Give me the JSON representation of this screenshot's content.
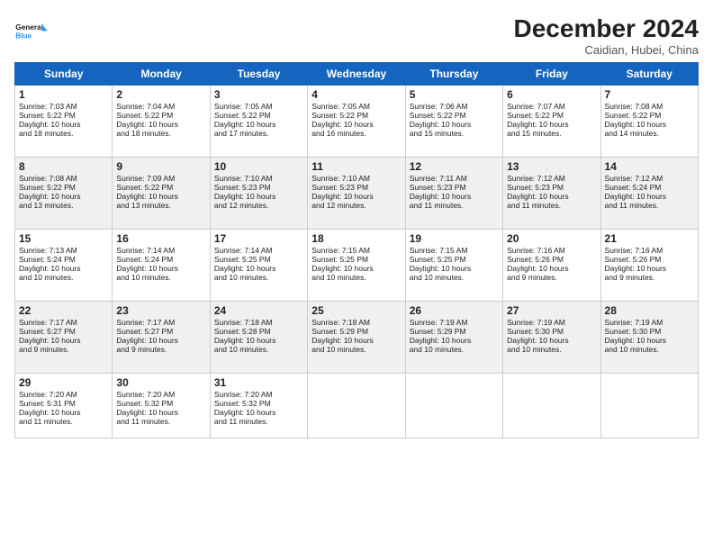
{
  "logo": {
    "line1": "General",
    "line2": "Blue"
  },
  "header": {
    "title": "December 2024",
    "location": "Caidian, Hubei, China"
  },
  "weekdays": [
    "Sunday",
    "Monday",
    "Tuesday",
    "Wednesday",
    "Thursday",
    "Friday",
    "Saturday"
  ],
  "weeks": [
    [
      {
        "day": 1,
        "lines": [
          "Sunrise: 7:03 AM",
          "Sunset: 5:22 PM",
          "Daylight: 10 hours",
          "and 18 minutes."
        ]
      },
      {
        "day": 2,
        "lines": [
          "Sunrise: 7:04 AM",
          "Sunset: 5:22 PM",
          "Daylight: 10 hours",
          "and 18 minutes."
        ]
      },
      {
        "day": 3,
        "lines": [
          "Sunrise: 7:05 AM",
          "Sunset: 5:22 PM",
          "Daylight: 10 hours",
          "and 17 minutes."
        ]
      },
      {
        "day": 4,
        "lines": [
          "Sunrise: 7:05 AM",
          "Sunset: 5:22 PM",
          "Daylight: 10 hours",
          "and 16 minutes."
        ]
      },
      {
        "day": 5,
        "lines": [
          "Sunrise: 7:06 AM",
          "Sunset: 5:22 PM",
          "Daylight: 10 hours",
          "and 15 minutes."
        ]
      },
      {
        "day": 6,
        "lines": [
          "Sunrise: 7:07 AM",
          "Sunset: 5:22 PM",
          "Daylight: 10 hours",
          "and 15 minutes."
        ]
      },
      {
        "day": 7,
        "lines": [
          "Sunrise: 7:08 AM",
          "Sunset: 5:22 PM",
          "Daylight: 10 hours",
          "and 14 minutes."
        ]
      }
    ],
    [
      {
        "day": 8,
        "lines": [
          "Sunrise: 7:08 AM",
          "Sunset: 5:22 PM",
          "Daylight: 10 hours",
          "and 13 minutes."
        ]
      },
      {
        "day": 9,
        "lines": [
          "Sunrise: 7:09 AM",
          "Sunset: 5:22 PM",
          "Daylight: 10 hours",
          "and 13 minutes."
        ]
      },
      {
        "day": 10,
        "lines": [
          "Sunrise: 7:10 AM",
          "Sunset: 5:23 PM",
          "Daylight: 10 hours",
          "and 12 minutes."
        ]
      },
      {
        "day": 11,
        "lines": [
          "Sunrise: 7:10 AM",
          "Sunset: 5:23 PM",
          "Daylight: 10 hours",
          "and 12 minutes."
        ]
      },
      {
        "day": 12,
        "lines": [
          "Sunrise: 7:11 AM",
          "Sunset: 5:23 PM",
          "Daylight: 10 hours",
          "and 11 minutes."
        ]
      },
      {
        "day": 13,
        "lines": [
          "Sunrise: 7:12 AM",
          "Sunset: 5:23 PM",
          "Daylight: 10 hours",
          "and 11 minutes."
        ]
      },
      {
        "day": 14,
        "lines": [
          "Sunrise: 7:12 AM",
          "Sunset: 5:24 PM",
          "Daylight: 10 hours",
          "and 11 minutes."
        ]
      }
    ],
    [
      {
        "day": 15,
        "lines": [
          "Sunrise: 7:13 AM",
          "Sunset: 5:24 PM",
          "Daylight: 10 hours",
          "and 10 minutes."
        ]
      },
      {
        "day": 16,
        "lines": [
          "Sunrise: 7:14 AM",
          "Sunset: 5:24 PM",
          "Daylight: 10 hours",
          "and 10 minutes."
        ]
      },
      {
        "day": 17,
        "lines": [
          "Sunrise: 7:14 AM",
          "Sunset: 5:25 PM",
          "Daylight: 10 hours",
          "and 10 minutes."
        ]
      },
      {
        "day": 18,
        "lines": [
          "Sunrise: 7:15 AM",
          "Sunset: 5:25 PM",
          "Daylight: 10 hours",
          "and 10 minutes."
        ]
      },
      {
        "day": 19,
        "lines": [
          "Sunrise: 7:15 AM",
          "Sunset: 5:25 PM",
          "Daylight: 10 hours",
          "and 10 minutes."
        ]
      },
      {
        "day": 20,
        "lines": [
          "Sunrise: 7:16 AM",
          "Sunset: 5:26 PM",
          "Daylight: 10 hours",
          "and 9 minutes."
        ]
      },
      {
        "day": 21,
        "lines": [
          "Sunrise: 7:16 AM",
          "Sunset: 5:26 PM",
          "Daylight: 10 hours",
          "and 9 minutes."
        ]
      }
    ],
    [
      {
        "day": 22,
        "lines": [
          "Sunrise: 7:17 AM",
          "Sunset: 5:27 PM",
          "Daylight: 10 hours",
          "and 9 minutes."
        ]
      },
      {
        "day": 23,
        "lines": [
          "Sunrise: 7:17 AM",
          "Sunset: 5:27 PM",
          "Daylight: 10 hours",
          "and 9 minutes."
        ]
      },
      {
        "day": 24,
        "lines": [
          "Sunrise: 7:18 AM",
          "Sunset: 5:28 PM",
          "Daylight: 10 hours",
          "and 10 minutes."
        ]
      },
      {
        "day": 25,
        "lines": [
          "Sunrise: 7:18 AM",
          "Sunset: 5:29 PM",
          "Daylight: 10 hours",
          "and 10 minutes."
        ]
      },
      {
        "day": 26,
        "lines": [
          "Sunrise: 7:19 AM",
          "Sunset: 5:29 PM",
          "Daylight: 10 hours",
          "and 10 minutes."
        ]
      },
      {
        "day": 27,
        "lines": [
          "Sunrise: 7:19 AM",
          "Sunset: 5:30 PM",
          "Daylight: 10 hours",
          "and 10 minutes."
        ]
      },
      {
        "day": 28,
        "lines": [
          "Sunrise: 7:19 AM",
          "Sunset: 5:30 PM",
          "Daylight: 10 hours",
          "and 10 minutes."
        ]
      }
    ],
    [
      {
        "day": 29,
        "lines": [
          "Sunrise: 7:20 AM",
          "Sunset: 5:31 PM",
          "Daylight: 10 hours",
          "and 11 minutes."
        ]
      },
      {
        "day": 30,
        "lines": [
          "Sunrise: 7:20 AM",
          "Sunset: 5:32 PM",
          "Daylight: 10 hours",
          "and 11 minutes."
        ]
      },
      {
        "day": 31,
        "lines": [
          "Sunrise: 7:20 AM",
          "Sunset: 5:32 PM",
          "Daylight: 10 hours",
          "and 11 minutes."
        ]
      },
      null,
      null,
      null,
      null
    ]
  ]
}
